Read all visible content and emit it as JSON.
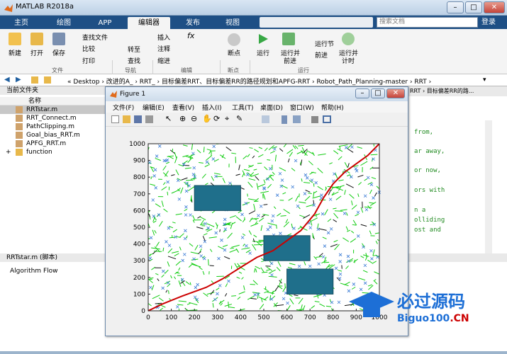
{
  "window": {
    "title": "MATLAB R2018a"
  },
  "tabs": [
    {
      "label": "主页"
    },
    {
      "label": "绘图"
    },
    {
      "label": "APP"
    },
    {
      "label": "编辑器"
    },
    {
      "label": "发布"
    },
    {
      "label": "视图"
    }
  ],
  "search": {
    "placeholder": "搜索文档"
  },
  "login": "登录",
  "ribbon": {
    "new": "新建",
    "open": "打开",
    "save": "保存",
    "find_file": "查找文件",
    "compare": "比较",
    "print": "打印",
    "goto": "转至",
    "find": "查找",
    "insert": "插入",
    "comment": "注释",
    "indent": "缩进",
    "breakpoint": "断点",
    "run": "运行",
    "run_advance_1": "运行并",
    "run_advance_2": "前进",
    "run_section": "运行节",
    "advance": "前进",
    "run_time_1": "运行并",
    "run_time_2": "计时",
    "groups": {
      "file": "文件",
      "navigate": "导航",
      "edit": "编辑",
      "breakpoints": "断点",
      "run": "运行"
    }
  },
  "address": {
    "path": "« Desktop › 改进的A_ › RRT_ › 目标偏差RRT、目标偏差RR的路径规划和APFG-RRT › Robot_Path_Planning-master › RRT ›"
  },
  "current_folder": {
    "title": "当前文件夹",
    "column": "名称",
    "files": [
      "RRTstar.m",
      "RRT_Connect.m",
      "PathClipping.m",
      "Goal_bias_RRT.m",
      "APFG_RRT.m"
    ],
    "folder": "function"
  },
  "details": {
    "title": "RRTstar.m  (脚本)",
    "desc": "Algorithm Flow"
  },
  "editor": {
    "path": "RRT › 目标偏差RR的路...",
    "lines": [
      "from,",
      "ar away,",
      "or now,",
      "ors with",
      "n a",
      "olliding",
      "ost and"
    ]
  },
  "figure": {
    "title": "Figure 1",
    "menu": [
      "文件(F)",
      "编辑(E)",
      "查看(V)",
      "插入(I)",
      "工具(T)",
      "桌面(D)",
      "窗口(W)",
      "帮助(H)"
    ]
  },
  "chart_data": {
    "type": "scatter",
    "xlim": [
      0,
      1000
    ],
    "ylim": [
      0,
      1000
    ],
    "xticks": [
      "0",
      "100",
      "200",
      "300",
      "400",
      "500",
      "600",
      "700",
      "800",
      "900",
      "1000"
    ],
    "yticks": [
      "0",
      "100",
      "200",
      "300",
      "400",
      "500",
      "600",
      "700",
      "800",
      "900",
      "1000"
    ],
    "obstacles": [
      {
        "x": [
          200,
          400
        ],
        "y": [
          600,
          750
        ]
      },
      {
        "x": [
          500,
          700
        ],
        "y": [
          300,
          450
        ]
      },
      {
        "x": [
          600,
          800
        ],
        "y": [
          100,
          250
        ]
      }
    ],
    "path": {
      "x": [
        0,
        60,
        150,
        250,
        320,
        400,
        470,
        540,
        600,
        660,
        720,
        760,
        800,
        850,
        900,
        950,
        1000
      ],
      "y": [
        0,
        40,
        90,
        140,
        190,
        260,
        320,
        360,
        420,
        480,
        580,
        680,
        760,
        830,
        880,
        930,
        1000
      ]
    },
    "grid": false,
    "colors": {
      "tree": "#11cc11",
      "nodes": "#3a7bd5",
      "obstacle": "#1f6f8b",
      "path": "#cc0000"
    }
  },
  "watermark": {
    "text": "必过源码",
    "url_main": "Biguo100",
    "url_tld": ".CN"
  },
  "colors": {
    "tab_bar": "#1e4f85",
    "accent": "#cc0000"
  }
}
